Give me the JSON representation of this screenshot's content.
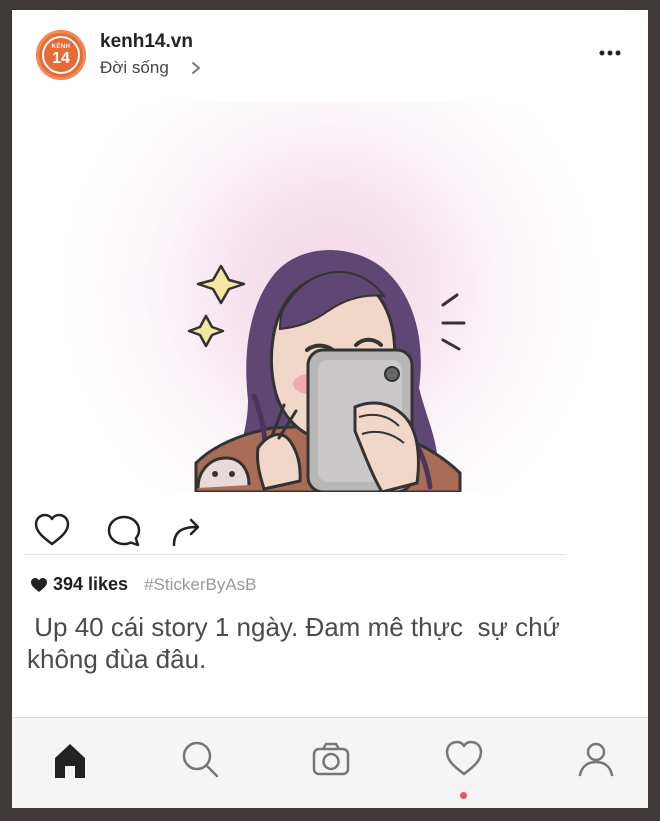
{
  "header": {
    "avatar_line1": "KÊNH",
    "avatar_line2": "14",
    "account_name": "kenh14.vn",
    "subtitle": "Đời sống",
    "icons": {
      "chevron": "chevron-right-icon",
      "more": "more-options-icon"
    }
  },
  "post": {
    "action_icons": [
      "heart-outline-icon",
      "comment-icon",
      "share-icon"
    ],
    "likes_count": "394 likes",
    "hashtag": "#StickerByAsB",
    "caption": " Up 40 cái story 1 ngày. Đam mê thực  sự chứ\nkhông đùa đâu."
  },
  "bottom_nav": {
    "items": [
      {
        "icon": "home-icon",
        "active": true
      },
      {
        "icon": "search-icon",
        "active": false
      },
      {
        "icon": "camera-icon",
        "active": false
      },
      {
        "icon": "heart-icon",
        "active": false
      },
      {
        "icon": "profile-icon",
        "active": false
      }
    ]
  },
  "colors": {
    "brand_orange": "#e86a37",
    "notification_dot": "#e1536b",
    "page_frame": "#3f3a37"
  }
}
